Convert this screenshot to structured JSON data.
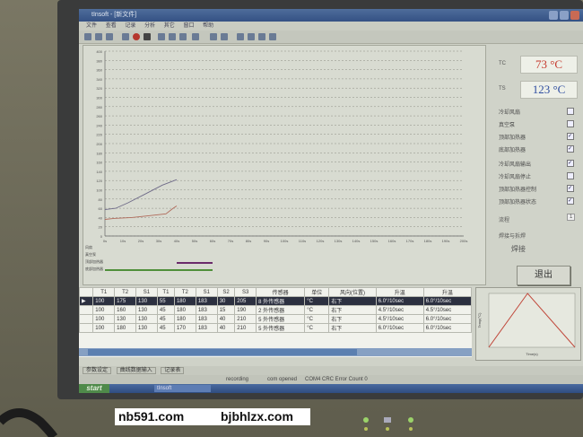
{
  "window": {
    "title": "tInsoft - [新文件]"
  },
  "menu": {
    "items": [
      "文件",
      "查看",
      "记录",
      "分析",
      "其它",
      "窗口",
      "帮助"
    ]
  },
  "chart_data": {
    "type": "line",
    "x": [
      0,
      10,
      20,
      30,
      40,
      50,
      60,
      70,
      80,
      90,
      100,
      110,
      120,
      130,
      140,
      150,
      160,
      170,
      180,
      190,
      200
    ],
    "y_ticks": [
      0,
      20,
      40,
      60,
      80,
      100,
      120,
      140,
      160,
      180,
      200,
      220,
      240,
      260,
      280,
      300,
      320,
      340,
      360,
      380,
      400
    ],
    "x_ticks": [
      "0s",
      "10s",
      "20s",
      "30s",
      "40s",
      "50s",
      "60s",
      "70s",
      "80s",
      "90s",
      "100s",
      "110s",
      "120s",
      "130s",
      "140s",
      "150s",
      "160s",
      "170s",
      "180s",
      "190s",
      "200s"
    ],
    "series": [
      {
        "name": "T1",
        "color": "#6e6a88",
        "points": [
          [
            0,
            57
          ],
          [
            6,
            60
          ],
          [
            13,
            72
          ],
          [
            22,
            90
          ],
          [
            32,
            110
          ],
          [
            40,
            122
          ]
        ]
      },
      {
        "name": "T2",
        "color": "#b06a5a",
        "points": [
          [
            0,
            36
          ],
          [
            5,
            38
          ],
          [
            15,
            40
          ],
          [
            25,
            44
          ],
          [
            34,
            48
          ],
          [
            38,
            60
          ],
          [
            40,
            65
          ]
        ]
      }
    ],
    "ylim": [
      0,
      400
    ],
    "xlim": [
      0,
      200
    ],
    "grid": true,
    "status_rows": [
      "风扇",
      "真空泵",
      "顶部加热器",
      "底部加热器"
    ]
  },
  "temps": {
    "tc_label": "TC",
    "tc_value": "73 °C",
    "ts_label": "TS",
    "ts_value": "123 °C"
  },
  "checks": [
    {
      "label": "冷却风扇",
      "checked": false
    },
    {
      "label": "真空泵",
      "checked": false
    },
    {
      "label": "顶部加热器",
      "checked": true
    },
    {
      "label": "底部加热器",
      "checked": true
    },
    {
      "label": "冷却风扇输出",
      "checked": true
    },
    {
      "label": "冷却风扇停止",
      "checked": false
    },
    {
      "label": "顶部加热器控制",
      "checked": true
    },
    {
      "label": "顶部加热器状态",
      "checked": true
    }
  ],
  "process": {
    "label": "流程",
    "value": "1"
  },
  "status_text": {
    "label": "焊接与拆焊",
    "value": "焊接"
  },
  "exit_button": "退出",
  "table": {
    "headers": [
      "",
      "T1",
      "T2",
      "S1",
      "T1",
      "T2",
      "S1",
      "S2",
      "S3",
      "传感器",
      "单位",
      "风向(位置)",
      "升温",
      "升温"
    ],
    "rows": [
      [
        "▶",
        "100",
        "175",
        "130",
        "55",
        "180",
        "183",
        "30",
        "205",
        "8 外传感器",
        "°C",
        "右下",
        "6.0°/10sec",
        "6.0°/10sec"
      ],
      [
        "",
        "100",
        "160",
        "130",
        "45",
        "180",
        "183",
        "15",
        "190",
        "2 外传感器",
        "°C",
        "右下",
        "4.5°/10sec",
        "4.5°/10sec"
      ],
      [
        "",
        "100",
        "130",
        "130",
        "45",
        "180",
        "183",
        "40",
        "210",
        "5 外传感器",
        "°C",
        "右下",
        "4.5°/10sec",
        "6.0°/10sec"
      ],
      [
        "",
        "100",
        "180",
        "130",
        "45",
        "170",
        "183",
        "40",
        "210",
        "5 外传感器",
        "°C",
        "右下",
        "6.0°/10sec",
        "6.0°/10sec"
      ]
    ]
  },
  "mini_chart": {
    "ylabel": "Temp(°C)",
    "xlabel": "Time(s)",
    "points": [
      [
        0,
        0
      ],
      [
        45,
        100
      ],
      [
        100,
        0
      ]
    ]
  },
  "bottom_tabs": [
    "参数设定",
    "曲线数据输入",
    "记录表"
  ],
  "status_bar": {
    "a": "recording",
    "b": "com opened",
    "c": "COM4 CRC Error Count 0"
  },
  "taskbar": {
    "start": "start",
    "task": "tInsoft"
  },
  "watermark": {
    "left": "nb591.com",
    "right": "bjbhlzx.com"
  }
}
